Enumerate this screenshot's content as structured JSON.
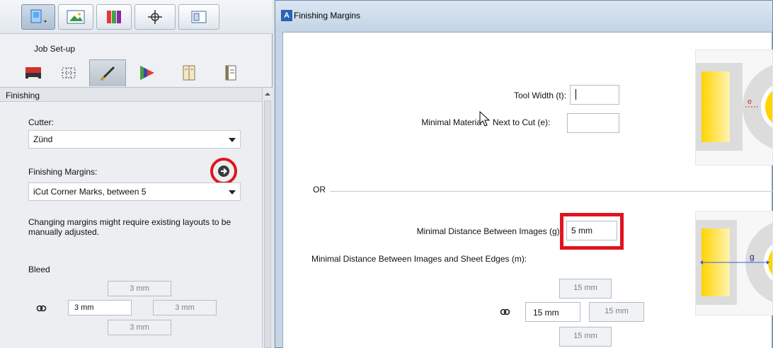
{
  "left_panel": {
    "section_title": "Job Set-up",
    "finishing_header": "Finishing",
    "cutter": {
      "label": "Cutter:",
      "value": "Zünd"
    },
    "finishing_margins": {
      "label": "Finishing Margins:",
      "value": "iCut Corner Marks, between 5"
    },
    "note": "Changing margins might require existing layouts to be manually adjusted.",
    "bleed": {
      "label": "Bleed",
      "top": "3 mm",
      "left": "3 mm",
      "right": "3 mm",
      "bottom": "3 mm"
    },
    "icons": {
      "toolbar": [
        "job-icon",
        "image-icon",
        "color-palette-icon",
        "target-icon",
        "layout-icon"
      ],
      "tabs": [
        "printer-icon",
        "grid-icon",
        "brush-icon",
        "color-wheel-icon",
        "book-icon",
        "document-icon"
      ]
    }
  },
  "dialog": {
    "title": "Finishing Margins",
    "app_icon_text": "A",
    "tool_width": {
      "label": "Tool Width (t):",
      "value": ""
    },
    "minimal_material": {
      "label": "Minimal Materia",
      "label_after_cursor": "Next to Cut (e):",
      "value": ""
    },
    "or_label": "OR",
    "min_distance_images": {
      "label": "Minimal Distance Between Images (g):",
      "value": "5 mm"
    },
    "min_distance_edges": {
      "label": "Minimal Distance Between Images and Sheet Edges (m):",
      "top": "15 mm",
      "left": "15 mm",
      "right": "15 mm",
      "bottom": "15 mm"
    },
    "diagram_labels": {
      "top": "e",
      "bottom": "g"
    }
  },
  "colors": {
    "highlight": "#e0141c",
    "yellow": "#ffd400",
    "accent_blue": "#2a62b4"
  }
}
